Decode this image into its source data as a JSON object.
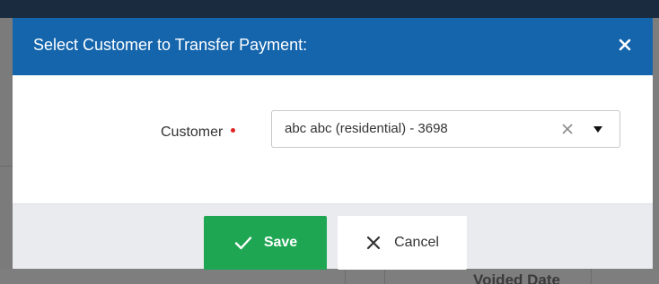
{
  "dialog": {
    "title": "Select Customer to Transfer Payment:",
    "close_symbol": "✕"
  },
  "form": {
    "customer_label": "Customer",
    "customer_required": true,
    "customer_value": "abc abc (residential) - 3698",
    "clear_symbol": "×",
    "caret_symbol": "▼"
  },
  "footer": {
    "save_label": "Save",
    "cancel_label": "Cancel"
  },
  "background": {
    "column_header_partial": "Voided Date"
  },
  "colors": {
    "header_bg": "#1565ad",
    "save_bg": "#1ea653",
    "footer_bg": "#e9ebee",
    "required_dot": "#e02424"
  },
  "icons": {
    "close": "close-icon",
    "clear": "clear-icon",
    "dropdown": "chevron-down-icon",
    "save": "check-icon",
    "cancel": "x-icon"
  }
}
